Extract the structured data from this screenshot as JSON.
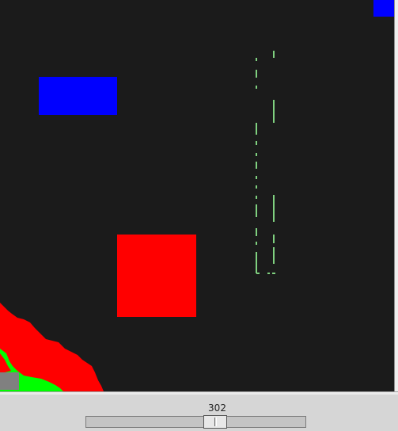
{
  "slider": {
    "value_label": "302",
    "position_fraction": 0.6
  },
  "colors": {
    "canvas_background": "#1b1b1b",
    "blue_block": "#0000ff",
    "red_block": "#ff0000",
    "dotted_path": "#7fd07f",
    "terrain_red": "#ff0000",
    "terrain_green": "#00ff00",
    "terrain_gray": "#808080"
  }
}
